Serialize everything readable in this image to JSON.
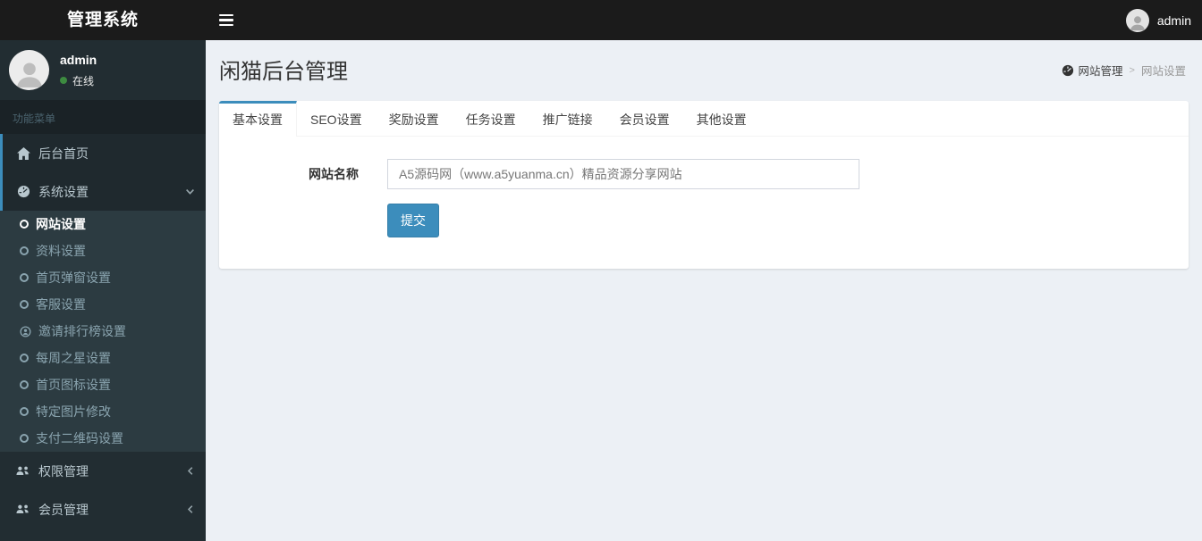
{
  "navbar": {
    "brand": "管理系统",
    "user_name": "admin"
  },
  "sidebar": {
    "user": {
      "name": "admin",
      "status": "在线"
    },
    "menu_header": "功能菜单",
    "items": [
      {
        "label": "后台首页",
        "icon": "home-icon",
        "active": true
      },
      {
        "label": "系统设置",
        "icon": "dashboard-icon",
        "state": "expanded",
        "active": true
      },
      {
        "label": "权限管理",
        "icon": "users-icon",
        "state": "collapsed"
      },
      {
        "label": "会员管理",
        "icon": "users-icon",
        "state": "collapsed"
      }
    ],
    "submenu": [
      {
        "label": "网站设置",
        "icon": "circle-icon",
        "active": true
      },
      {
        "label": "资料设置",
        "icon": "circle-icon"
      },
      {
        "label": "首页弹窗设置",
        "icon": "circle-icon"
      },
      {
        "label": "客服设置",
        "icon": "circle-icon"
      },
      {
        "label": "邀请排行榜设置",
        "icon": "user-circle-icon"
      },
      {
        "label": "每周之星设置",
        "icon": "circle-icon"
      },
      {
        "label": "首页图标设置",
        "icon": "circle-icon"
      },
      {
        "label": "特定图片修改",
        "icon": "circle-icon"
      },
      {
        "label": "支付二维码设置",
        "icon": "circle-icon"
      }
    ]
  },
  "content": {
    "page_title": "闲猫后台管理",
    "breadcrumb": {
      "icon": "dashboard-icon",
      "section": "网站管理",
      "separator": ">",
      "current": "网站设置"
    },
    "tabs": [
      {
        "label": "基本设置",
        "active": true
      },
      {
        "label": "SEO设置"
      },
      {
        "label": "奖励设置"
      },
      {
        "label": "任务设置"
      },
      {
        "label": "推广链接"
      },
      {
        "label": "会员设置"
      },
      {
        "label": "其他设置"
      }
    ],
    "form": {
      "site_name_label": "网站名称",
      "site_name_value": "A5源码网（www.a5yuanma.cn）精品资源分享网站",
      "submit_label": "提交"
    }
  },
  "colors": {
    "accent": "#3c8dbc",
    "navbar_bg": "#1b1b1b",
    "sidebar_bg": "#222d32",
    "submenu_bg": "#2c3b41",
    "content_bg": "#ecf0f5",
    "online_dot": "#3d8b40"
  }
}
